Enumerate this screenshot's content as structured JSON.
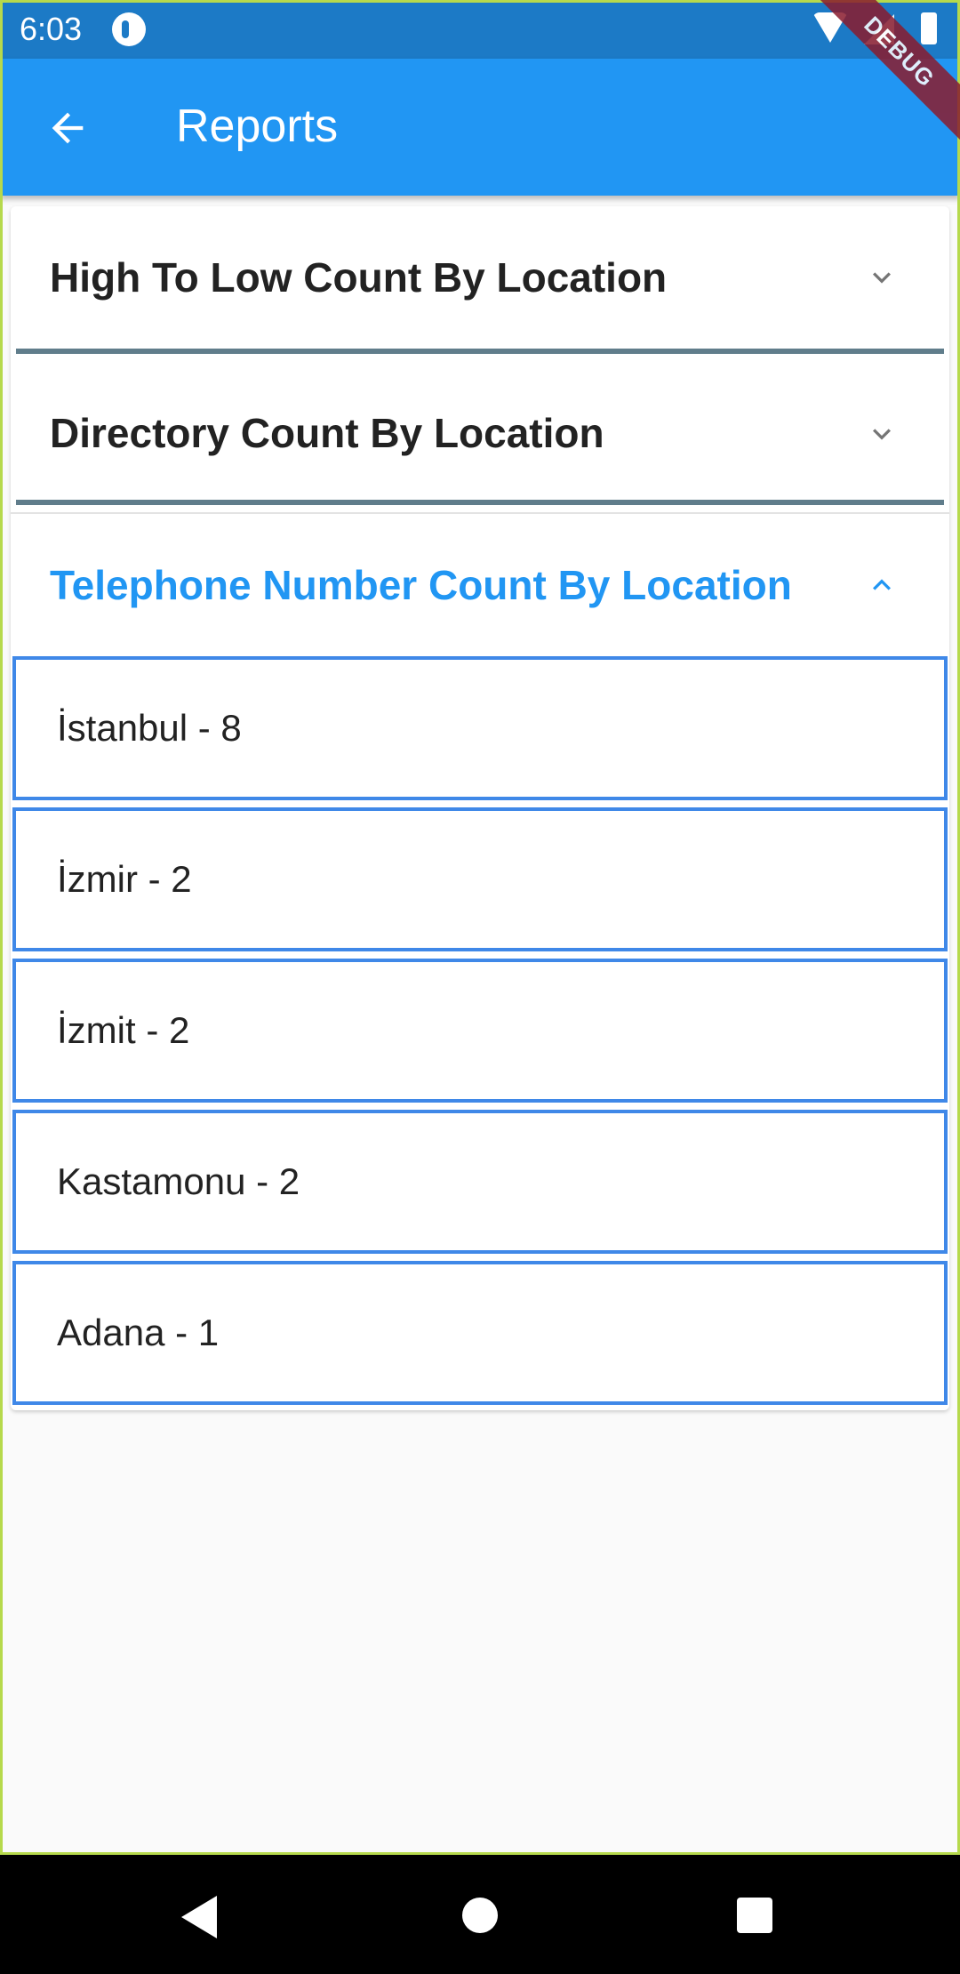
{
  "status_bar": {
    "time": "6:03",
    "icons": [
      "app-notification-icon",
      "wifi-icon",
      "signal-icon",
      "battery-icon"
    ]
  },
  "app_bar": {
    "title": "Reports",
    "back_icon": "arrow-back-icon",
    "debug_label": "DEBUG",
    "color": "#2196f3"
  },
  "panels": [
    {
      "title": "High To Low Count By Location",
      "expanded": false
    },
    {
      "title": "Directory Count By Location",
      "expanded": false
    },
    {
      "title": "Telephone Number Count By Location",
      "expanded": true,
      "items": [
        "İstanbul - 8",
        "İzmir - 2",
        "İzmit - 2",
        "Kastamonu - 2",
        "Adana - 1"
      ]
    }
  ],
  "colors": {
    "accent": "#2196f3",
    "item_border": "#3f88e8",
    "divider": "#607d8b"
  },
  "nav_bar": {
    "icons": [
      "nav-back-icon",
      "nav-home-icon",
      "nav-recents-icon"
    ]
  }
}
